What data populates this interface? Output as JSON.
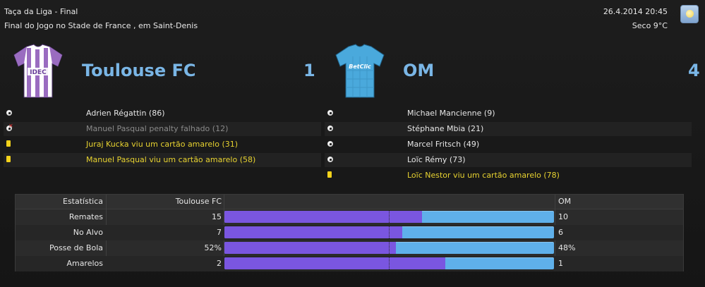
{
  "header": {
    "competition": "Taça da Liga - Final",
    "venue": "Final do Jogo no Stade de France , em Saint-Denis",
    "datetime": "26.4.2014 20:45",
    "weather": "Seco 9°C",
    "weather_icon": "sun-icon"
  },
  "home": {
    "name": "Toulouse FC",
    "score": "1",
    "kit_sponsor": "IDEC",
    "kit_colors": [
      "#9a6cc0",
      "#ffffff"
    ]
  },
  "away": {
    "name": "OM",
    "score": "4",
    "kit_sponsor": "BetClic",
    "kit_colors": [
      "#4aa9dc"
    ]
  },
  "home_events": [
    {
      "icon": "goal-ball-icon",
      "text": "Adrien Régattin (86)",
      "style": "normal"
    },
    {
      "icon": "missed-penalty-icon",
      "text": "Manuel Pasqual penalty falhado (12)",
      "style": "grey"
    },
    {
      "icon": "yellow-card-icon",
      "text": "Juraj Kucka viu um cartão amarelo (31)",
      "style": "yellow"
    },
    {
      "icon": "yellow-card-icon",
      "text": "Manuel Pasqual viu um cartão amarelo (58)",
      "style": "yellow"
    }
  ],
  "away_events": [
    {
      "icon": "goal-ball-icon",
      "text": "Michael Mancienne (9)",
      "style": "normal"
    },
    {
      "icon": "goal-ball-icon",
      "text": "Stéphane Mbia (21)",
      "style": "normal"
    },
    {
      "icon": "goal-ball-icon",
      "text": "Marcel Fritsch (49)",
      "style": "normal"
    },
    {
      "icon": "goal-ball-icon",
      "text": "Loïc Rémy (73)",
      "style": "normal"
    },
    {
      "icon": "yellow-card-icon",
      "text": "Loïc Nestor viu um cartão amarelo (78)",
      "style": "yellow"
    }
  ],
  "stats": {
    "header_label": "Estatística",
    "header_home": "Toulouse FC",
    "header_away": "OM",
    "home_color": "#7a56e0",
    "away_color": "#5fb0ea",
    "rows": [
      {
        "label": "Remates",
        "home": "15",
        "away": "10",
        "home_share": 0.6
      },
      {
        "label": "No Alvo",
        "home": "7",
        "away": "6",
        "home_share": 0.54
      },
      {
        "label": "Posse de Bola",
        "home": "52%",
        "away": "48%",
        "home_share": 0.52
      },
      {
        "label": "Amarelos",
        "home": "2",
        "away": "1",
        "home_share": 0.67
      }
    ]
  }
}
